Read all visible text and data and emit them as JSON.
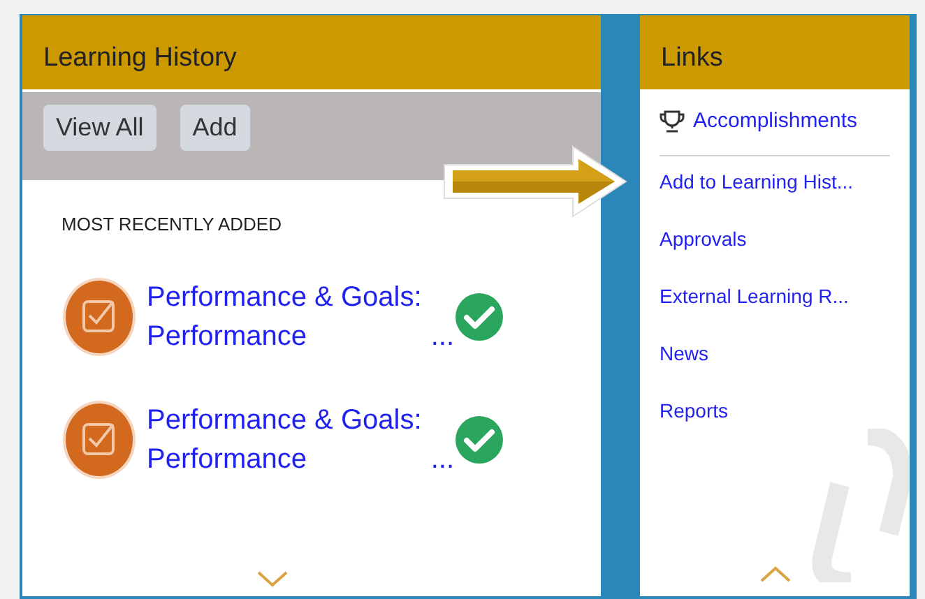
{
  "learning_history": {
    "title": "Learning History",
    "buttons": [
      "View All",
      "Add"
    ],
    "section_label": "MOST RECENTLY ADDED",
    "items": [
      {
        "title": "Performance & Goals:",
        "subtitle": "Performance",
        "ellipsis": "...",
        "completed": true
      },
      {
        "title": "Performance & Goals:",
        "subtitle": "Performance",
        "ellipsis": "...",
        "completed": true
      }
    ]
  },
  "links": {
    "title": "Links",
    "featured": "Accomplishments",
    "items": [
      "Add to Learning Hist...",
      "Approvals",
      "External Learning R...",
      "News",
      "Reports"
    ]
  }
}
